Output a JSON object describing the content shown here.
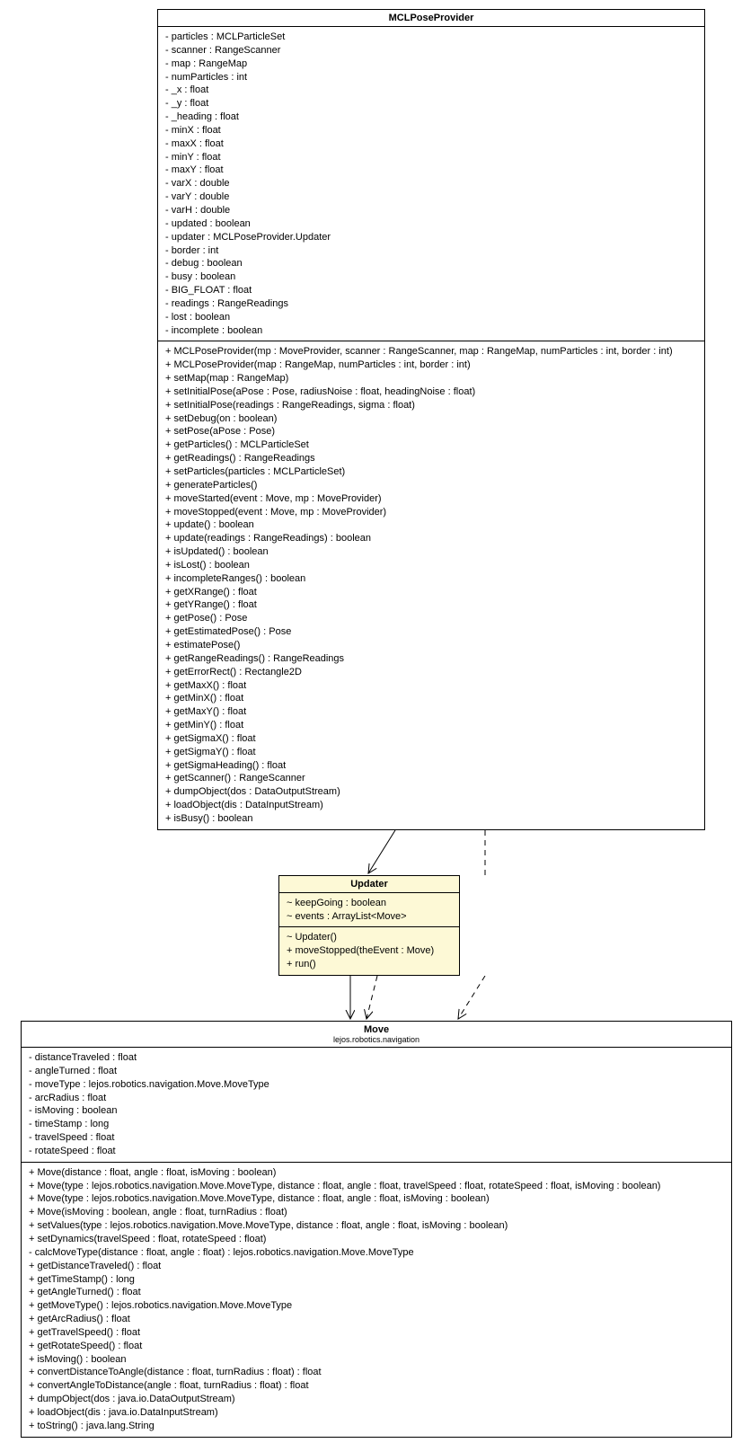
{
  "classes": {
    "mcl": {
      "name": "MCLPoseProvider",
      "attrs": [
        "- particles : MCLParticleSet",
        "- scanner : RangeScanner",
        "- map : RangeMap",
        "- numParticles : int",
        "- _x : float",
        "- _y : float",
        "- _heading : float",
        "- minX : float",
        "- maxX : float",
        "- minY : float",
        "- maxY : float",
        "- varX : double",
        "- varY : double",
        "- varH : double",
        "- updated : boolean",
        "- updater : MCLPoseProvider.Updater",
        "- border : int",
        "- debug : boolean",
        "- busy : boolean",
        "- BIG_FLOAT : float",
        "- readings : RangeReadings",
        "- lost : boolean",
        "- incomplete : boolean"
      ],
      "ops": [
        "+ MCLPoseProvider(mp : MoveProvider, scanner : RangeScanner, map : RangeMap, numParticles : int, border : int)",
        "+ MCLPoseProvider(map : RangeMap, numParticles : int, border : int)",
        "+ setMap(map : RangeMap)",
        "+ setInitialPose(aPose : Pose, radiusNoise : float, headingNoise : float)",
        "+ setInitialPose(readings : RangeReadings, sigma : float)",
        "+ setDebug(on : boolean)",
        "+ setPose(aPose : Pose)",
        "+ getParticles() : MCLParticleSet",
        "+ getReadings() : RangeReadings",
        "+ setParticles(particles : MCLParticleSet)",
        "+ generateParticles()",
        "+ moveStarted(event : Move, mp : MoveProvider)",
        "+ moveStopped(event : Move, mp : MoveProvider)",
        "+ update() : boolean",
        "+ update(readings : RangeReadings) : boolean",
        "+ isUpdated() : boolean",
        "+ isLost() : boolean",
        "+ incompleteRanges() : boolean",
        "+ getXRange() : float",
        "+ getYRange() : float",
        "+ getPose() : Pose",
        "+ getEstimatedPose() : Pose",
        "+ estimatePose()",
        "+ getRangeReadings() : RangeReadings",
        "+ getErrorRect() : Rectangle2D",
        "+ getMaxX() : float",
        "+ getMinX() : float",
        "+ getMaxY() : float",
        "+ getMinY() : float",
        "+ getSigmaX() : float",
        "+ getSigmaY() : float",
        "+ getSigmaHeading() : float",
        "+ getScanner() : RangeScanner",
        "+ dumpObject(dos : DataOutputStream)",
        "+ loadObject(dis : DataInputStream)",
        "+ isBusy() : boolean"
      ]
    },
    "updater": {
      "name": "Updater",
      "attrs": [
        "~ keepGoing : boolean",
        "~ events : ArrayList<Move>"
      ],
      "ops": [
        "~ Updater()",
        "+ moveStopped(theEvent : Move)",
        "+ run()"
      ]
    },
    "move": {
      "name": "Move",
      "package": "lejos.robotics.navigation",
      "attrs": [
        "- distanceTraveled : float",
        "- angleTurned : float",
        "- moveType : lejos.robotics.navigation.Move.MoveType",
        "- arcRadius : float",
        "- isMoving : boolean",
        "- timeStamp : long",
        "- travelSpeed : float",
        "- rotateSpeed : float"
      ],
      "ops": [
        "+ Move(distance : float, angle : float, isMoving : boolean)",
        "+ Move(type : lejos.robotics.navigation.Move.MoveType, distance : float, angle : float, travelSpeed : float, rotateSpeed : float, isMoving : boolean)",
        "+ Move(type : lejos.robotics.navigation.Move.MoveType, distance : float, angle : float, isMoving : boolean)",
        "+ Move(isMoving : boolean, angle : float, turnRadius : float)",
        "+ setValues(type : lejos.robotics.navigation.Move.MoveType, distance : float, angle : float, isMoving : boolean)",
        "+ setDynamics(travelSpeed : float, rotateSpeed : float)",
        "- calcMoveType(distance : float, angle : float) : lejos.robotics.navigation.Move.MoveType",
        "+ getDistanceTraveled() : float",
        "+ getTimeStamp() : long",
        "+ getAngleTurned() : float",
        "+ getMoveType() : lejos.robotics.navigation.Move.MoveType",
        "+ getArcRadius() : float",
        "+ getTravelSpeed() : float",
        "+ getRotateSpeed() : float",
        "+ isMoving() : boolean",
        "+ convertDistanceToAngle(distance : float, turnRadius : float) : float",
        "+ convertAngleToDistance(angle : float, turnRadius : float) : float",
        "+ dumpObject(dos : java.io.DataOutputStream)",
        "+ loadObject(dis : java.io.DataInputStream)",
        "+ toString() : java.lang.String"
      ]
    }
  }
}
